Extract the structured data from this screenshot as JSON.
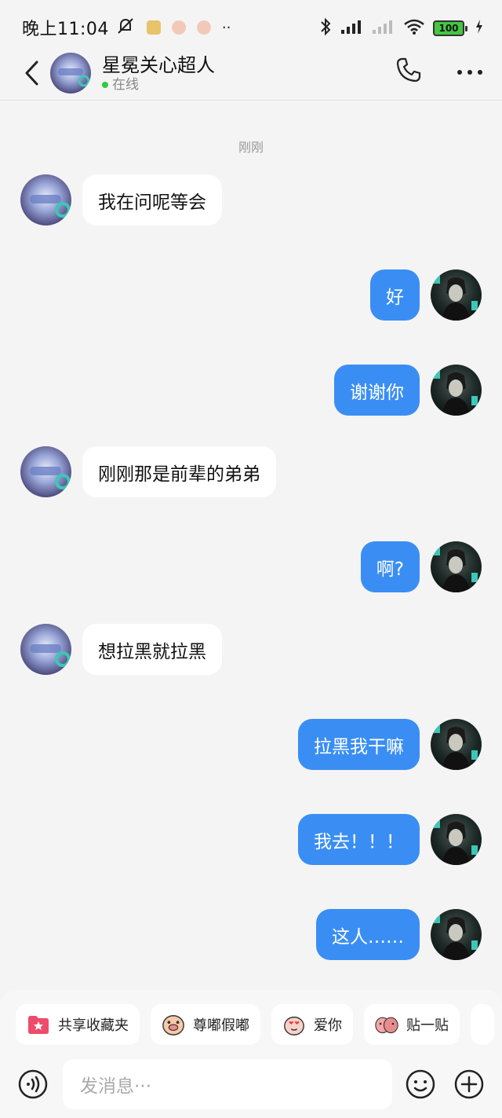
{
  "status_bar": {
    "time": "晚上11:04",
    "battery": "100"
  },
  "header": {
    "contact_name": "星冕关心超人",
    "presence": "在线"
  },
  "timestamp": "刚刚",
  "messages": [
    {
      "side": "left",
      "text": "我在问呢等会"
    },
    {
      "side": "right",
      "text": "好"
    },
    {
      "side": "right",
      "text": "谢谢你"
    },
    {
      "side": "left",
      "text": "刚刚那是前辈的弟弟"
    },
    {
      "side": "right",
      "text": "啊?"
    },
    {
      "side": "left",
      "text": "想拉黑就拉黑"
    },
    {
      "side": "right",
      "text": "拉黑我干嘛"
    },
    {
      "side": "right",
      "text": "我去！！！"
    },
    {
      "side": "right",
      "text": "这人……"
    }
  ],
  "quick_actions": [
    {
      "label": "共享收藏夹",
      "icon": "shared-favorites-icon"
    },
    {
      "label": "尊嘟假嘟",
      "icon": "pig-face-sticker-icon"
    },
    {
      "label": "爱你",
      "icon": "love-sticker-icon"
    },
    {
      "label": "贴一贴",
      "icon": "cuddle-sticker-icon"
    }
  ],
  "input": {
    "placeholder": "发消息···"
  },
  "colors": {
    "bubble_outgoing": "#3a8ef3",
    "bubble_incoming": "#ffffff",
    "background": "#f4f4f4",
    "online_dot": "#2ecc40"
  }
}
